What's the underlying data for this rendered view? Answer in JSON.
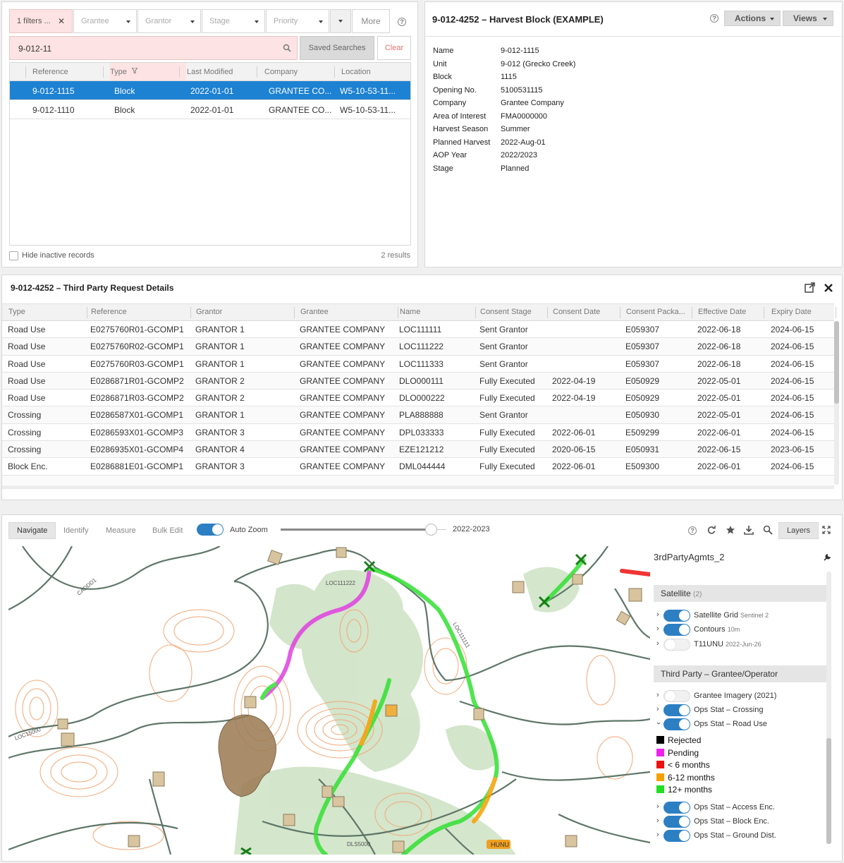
{
  "search": {
    "active_filter": "1 filters ...",
    "filters": [
      "Grantee",
      "Grantor",
      "Stage",
      "Priority"
    ],
    "more_label": "More",
    "query": "9-012-11",
    "saved_searches_label": "Saved Searches",
    "clear_label": "Clear",
    "columns": [
      "Reference",
      "Type",
      "Last Modified",
      "Company",
      "Location"
    ],
    "rows": [
      {
        "reference": "9-012-1115",
        "type": "Block",
        "modified": "2022-01-01",
        "company": "GRANTEE CO...",
        "location": "W5-10-53-11..."
      },
      {
        "reference": "9-012-1110",
        "type": "Block",
        "modified": "2022-01-01",
        "company": "GRANTEE CO...",
        "location": "W5-10-53-11..."
      }
    ],
    "hide_inactive_label": "Hide inactive records",
    "results_count": "2 results"
  },
  "detail": {
    "title": "9-012-4252 – Harvest Block (EXAMPLE)",
    "actions_label": "Actions",
    "views_label": "Views",
    "fields": [
      {
        "key": "Name",
        "value": "9-012-1115"
      },
      {
        "key": "Unit",
        "value": "9-012 (Grecko Creek)"
      },
      {
        "key": "Block",
        "value": "1115"
      },
      {
        "key": "Opening No.",
        "value": "5100531115"
      },
      {
        "key": "Company",
        "value": "Grantee Company"
      },
      {
        "key": "Area of Interest",
        "value": "FMA0000000"
      },
      {
        "key": "Harvest Season",
        "value": "Summer"
      },
      {
        "key": "Planned Harvest",
        "value": "2022-Aug-01"
      },
      {
        "key": "AOP Year",
        "value": "2022/2023"
      },
      {
        "key": "Stage",
        "value": "Planned"
      }
    ]
  },
  "third_party": {
    "title": "9-012-4252 – Third Party Request Details",
    "columns": [
      "Type",
      "Reference",
      "Grantor",
      "Grantee",
      "Name",
      "Consent Stage",
      "Consent Date",
      "Consent Packa...",
      "Effective Date",
      "Expiry Date"
    ],
    "rows": [
      [
        "Road Use",
        "E0275760R01-GCOMP1",
        "GRANTOR 1",
        "GRANTEE COMPANY",
        "LOC111111",
        "Sent Grantor",
        "",
        "E059307",
        "2022-06-18",
        "2024-06-15"
      ],
      [
        "Road Use",
        "E0275760R02-GCOMP1",
        "GRANTOR 1",
        "GRANTEE COMPANY",
        "LOC111222",
        "Sent Grantor",
        "",
        "E059307",
        "2022-06-18",
        "2024-06-15"
      ],
      [
        "Road Use",
        "E0275760R03-GCOMP1",
        "GRANTOR 1",
        "GRANTEE COMPANY",
        "LOC111333",
        "Sent Grantor",
        "",
        "E059307",
        "2022-06-18",
        "2024-06-15"
      ],
      [
        "Road Use",
        "E0286871R01-GCOMP2",
        "GRANTOR 2",
        "GRANTEE COMPANY",
        "DLO000111",
        "Fully Executed",
        "2022-04-19",
        "E050929",
        "2022-05-01",
        "2024-06-15"
      ],
      [
        "Road Use",
        "E0286871R03-GCOMP2",
        "GRANTOR 2",
        "GRANTEE COMPANY",
        "DLO000222",
        "Fully Executed",
        "2022-04-19",
        "E050929",
        "2022-05-01",
        "2024-06-15"
      ],
      [
        "Crossing",
        "E0286587X01-GCOMP1",
        "GRANTOR 1",
        "GRANTEE COMPANY",
        "PLA888888",
        "Sent Grantor",
        "",
        "E050930",
        "2022-05-01",
        "2024-06-15"
      ],
      [
        "Crossing",
        "E0286593X01-GCOMP3",
        "GRANTOR 3",
        "GRANTEE COMPANY",
        "DPL033333",
        "Fully Executed",
        "2022-06-01",
        "E509299",
        "2022-06-01",
        "2024-06-15"
      ],
      [
        "Crossing",
        "E0286935X01-GCOMP4",
        "GRANTOR 4",
        "GRANTEE COMPANY",
        "EZE121212",
        "Fully Executed",
        "2020-06-15",
        "E050931",
        "2022-06-15",
        "2023-06-15"
      ],
      [
        "Block Enc.",
        "E0286881E01-GCOMP1",
        "GRANTOR 3",
        "GRANTEE COMPANY",
        "DML044444",
        "Fully Executed",
        "2022-06-01",
        "E509300",
        "2022-06-01",
        "2024-06-15"
      ]
    ]
  },
  "map": {
    "tools": [
      "Navigate",
      "Identify",
      "Measure",
      "Bulk Edit"
    ],
    "auto_zoom_label": "Auto Zoom",
    "year_label": "2022-2023",
    "year_slider_position": 0.95,
    "layers_button_label": "Layers",
    "layer_set_name": "3rdPartyAgmts_2",
    "groups": [
      {
        "name": "Satellite",
        "count": "(2)",
        "layers": [
          {
            "label": "Satellite Grid",
            "sub": "Sentinel 2",
            "on": true
          },
          {
            "label": "Contours",
            "sub": "10m",
            "on": true
          },
          {
            "label": "T11UNU",
            "sub": "2022-Jun-26",
            "on": false
          }
        ]
      },
      {
        "name": "Third Party – Grantee/Operator",
        "count": "",
        "layers": [
          {
            "label": "Grantee Imagery (2021)",
            "sub": "",
            "on": false
          },
          {
            "label": "Ops Stat – Crossing",
            "sub": "",
            "on": true
          },
          {
            "label": "Ops Stat – Road Use",
            "sub": "",
            "on": true
          }
        ]
      }
    ],
    "legend": [
      {
        "label": "Rejected",
        "color": "#000000"
      },
      {
        "label": "Pending",
        "color": "#ee22ee"
      },
      {
        "label": "< 6 months",
        "color": "#ee1111"
      },
      {
        "label": "6-12 months",
        "color": "#f5a000"
      },
      {
        "label": "12+ months",
        "color": "#22dd22"
      }
    ],
    "more_layers": [
      "Ops Stat – Access Enc.",
      "Ops Stat – Block Enc.",
      "Ops Stat – Ground Dist."
    ],
    "map_labels": [
      "LOC111111",
      "LOC111222",
      "LOC15000",
      "DLS5000",
      "CADDD1",
      "HUNU"
    ]
  },
  "colors": {
    "accent": "#1e82d2",
    "filter_active": "#fde3e3"
  }
}
